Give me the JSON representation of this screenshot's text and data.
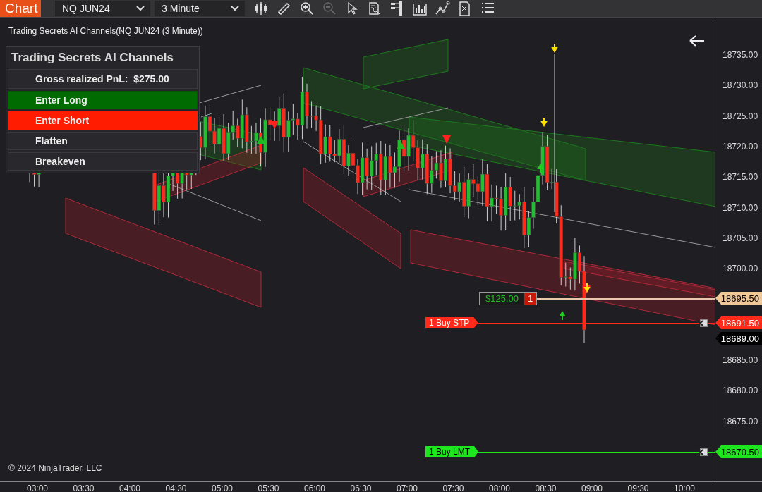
{
  "toolbar": {
    "title": "Chart",
    "instrument": "NQ JUN24",
    "interval": "3 Minute"
  },
  "chart": {
    "title": "Trading Secrets AI Channels(NQ JUN24 (3 Minute))",
    "copyright": "© 2024 NinjaTrader, LLC",
    "price_labels_upper": [
      "18735.00",
      "18730.00",
      "18725.00",
      "18720.00",
      "18715.00",
      "18710.00",
      "18705.00",
      "18700.00"
    ],
    "price_labels_lower": [
      "18685.00",
      "18680.00",
      "18675.00"
    ],
    "time_labels": [
      "03:00",
      "03:30",
      "04:00",
      "04:30",
      "05:00",
      "05:30",
      "06:00",
      "06:30",
      "07:00",
      "07:30",
      "08:00",
      "08:30",
      "09:00",
      "09:30",
      "10:00"
    ],
    "position": {
      "pnl": "$125.00",
      "quantity": "1"
    },
    "orders": [
      {
        "label": "1 Buy STP",
        "kind": "stop"
      },
      {
        "label": "1 Buy LMT",
        "kind": "limit"
      }
    ],
    "markers": [
      {
        "text": "18695.50",
        "kind": "position"
      },
      {
        "text": "18691.50",
        "kind": "stop"
      },
      {
        "text": "18689.00",
        "kind": "last"
      },
      {
        "text": "18670.50",
        "kind": "limit"
      }
    ]
  },
  "panel": {
    "title": "Trading Secrets AI Channels",
    "rows": [
      {
        "label": "Gross realized PnL:  $275.00",
        "kind": "info"
      },
      {
        "label": "Enter Long",
        "kind": "long"
      },
      {
        "label": "Enter Short",
        "kind": "short"
      },
      {
        "label": "Flatten",
        "kind": "plain"
      },
      {
        "label": "Breakeven",
        "kind": "plain"
      }
    ]
  }
}
